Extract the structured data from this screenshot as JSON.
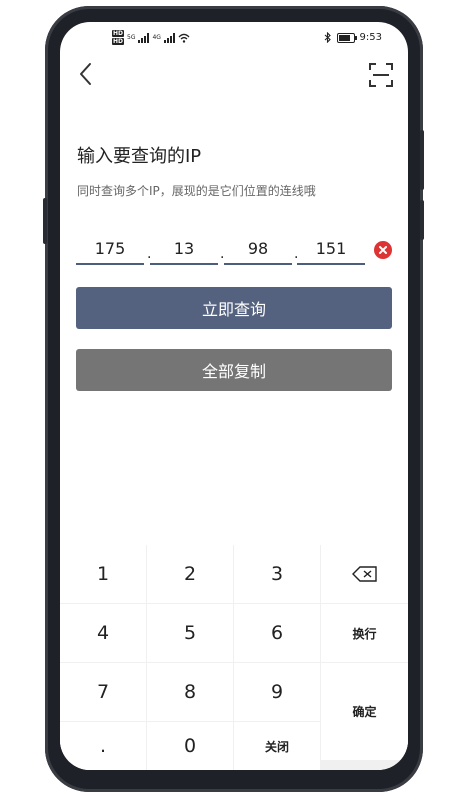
{
  "status_bar": {
    "hd_badges": [
      "HD",
      "HD"
    ],
    "network_1": "5G",
    "network_2": "4G",
    "time": "9:53",
    "battery_level": 0.8
  },
  "header": {
    "title": "输入要查询的IP",
    "subtitle": "同时查询多个IP，展现的是它们位置的连线哦"
  },
  "ip": {
    "octets": [
      "175",
      "13",
      "98",
      "151"
    ],
    "separator": "."
  },
  "actions": {
    "query_label": "立即查询",
    "copy_label": "全部复制"
  },
  "keypad": {
    "keys": [
      "1",
      "2",
      "3",
      "4",
      "5",
      "6",
      "7",
      "8",
      "9",
      ".",
      "0"
    ],
    "newline_label": "换行",
    "confirm_label": "确定",
    "close_label": "关闭"
  },
  "colors": {
    "primary": "#54627f",
    "secondary": "#757575",
    "clear": "#dd3333",
    "frame": "#1f2128"
  }
}
